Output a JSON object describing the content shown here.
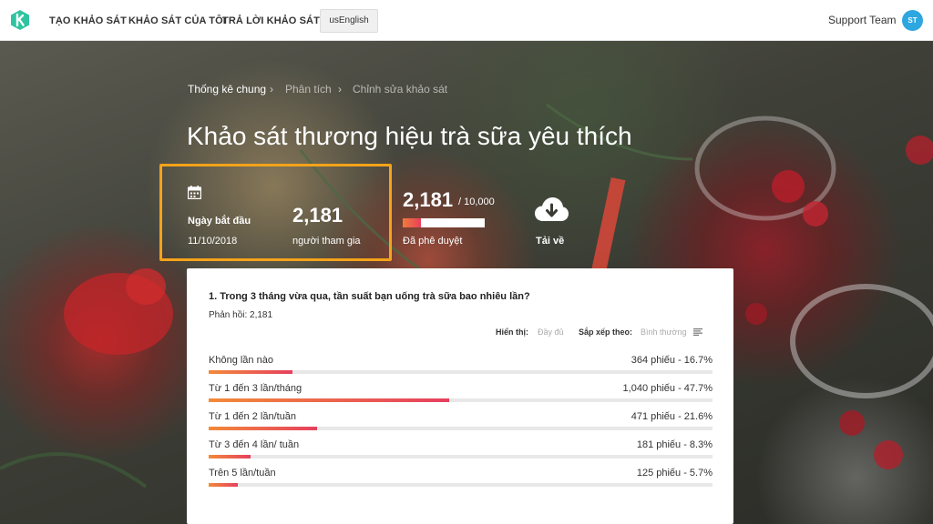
{
  "nav": {
    "links": [
      "TẠO KHẢO SÁT",
      "KHẢO SÁT CỦA TÔI",
      "TRẢ LỜI KHẢO SÁT"
    ],
    "language_button": "usEnglish",
    "team_name": "Support Team",
    "avatar_initials": "ST"
  },
  "breadcrumb": {
    "items": [
      "Thống kê chung",
      "Phân tích",
      "Chỉnh sửa khảo sát"
    ],
    "separator": "›"
  },
  "page_title": "Khảo sát thương hiệu trà sữa yêu thích",
  "stats": {
    "start_label": "Ngày bắt đầu",
    "start_date": "11/10/2018",
    "participants_count": "2,181",
    "participants_label": "người tham gia",
    "approved_count": "2,181",
    "approved_total": "/ 10,000",
    "approved_fraction": 0.2181,
    "approved_label": "Đã phê duyệt",
    "download_label": "Tải về"
  },
  "question": {
    "title": "1.  Trong 3 tháng vừa qua, tần suất bạn uống trà sữa bao nhiêu lần?",
    "responses": "Phản hồi: 2,181",
    "display_label": "Hiển thị:",
    "display_value": "Đầy đủ",
    "sort_label": "Sắp xếp theo:",
    "sort_value": "Bình thường",
    "answers": [
      {
        "label": "Không lần nào",
        "value": "364 phiếu - 16.7%",
        "percent": 16.7
      },
      {
        "label": "Từ 1 đến 3 lần/tháng",
        "value": "1,040 phiếu - 47.7%",
        "percent": 47.7
      },
      {
        "label": "Từ 1 đến 2 lần/tuần",
        "value": "471 phiếu - 21.6%",
        "percent": 21.6
      },
      {
        "label": "Từ 3 đến 4 lần/ tuần",
        "value": "181 phiếu - 8.3%",
        "percent": 8.3
      },
      {
        "label": "Trên 5 lần/tuần",
        "value": "125 phiếu - 5.7%",
        "percent": 5.7
      }
    ]
  },
  "colors": {
    "brand": "#2fc4a0",
    "highlight_border": "#f5a31a",
    "bar_start": "#f28a3a",
    "bar_end": "#e6405f",
    "avatar": "#2ea6e0"
  }
}
